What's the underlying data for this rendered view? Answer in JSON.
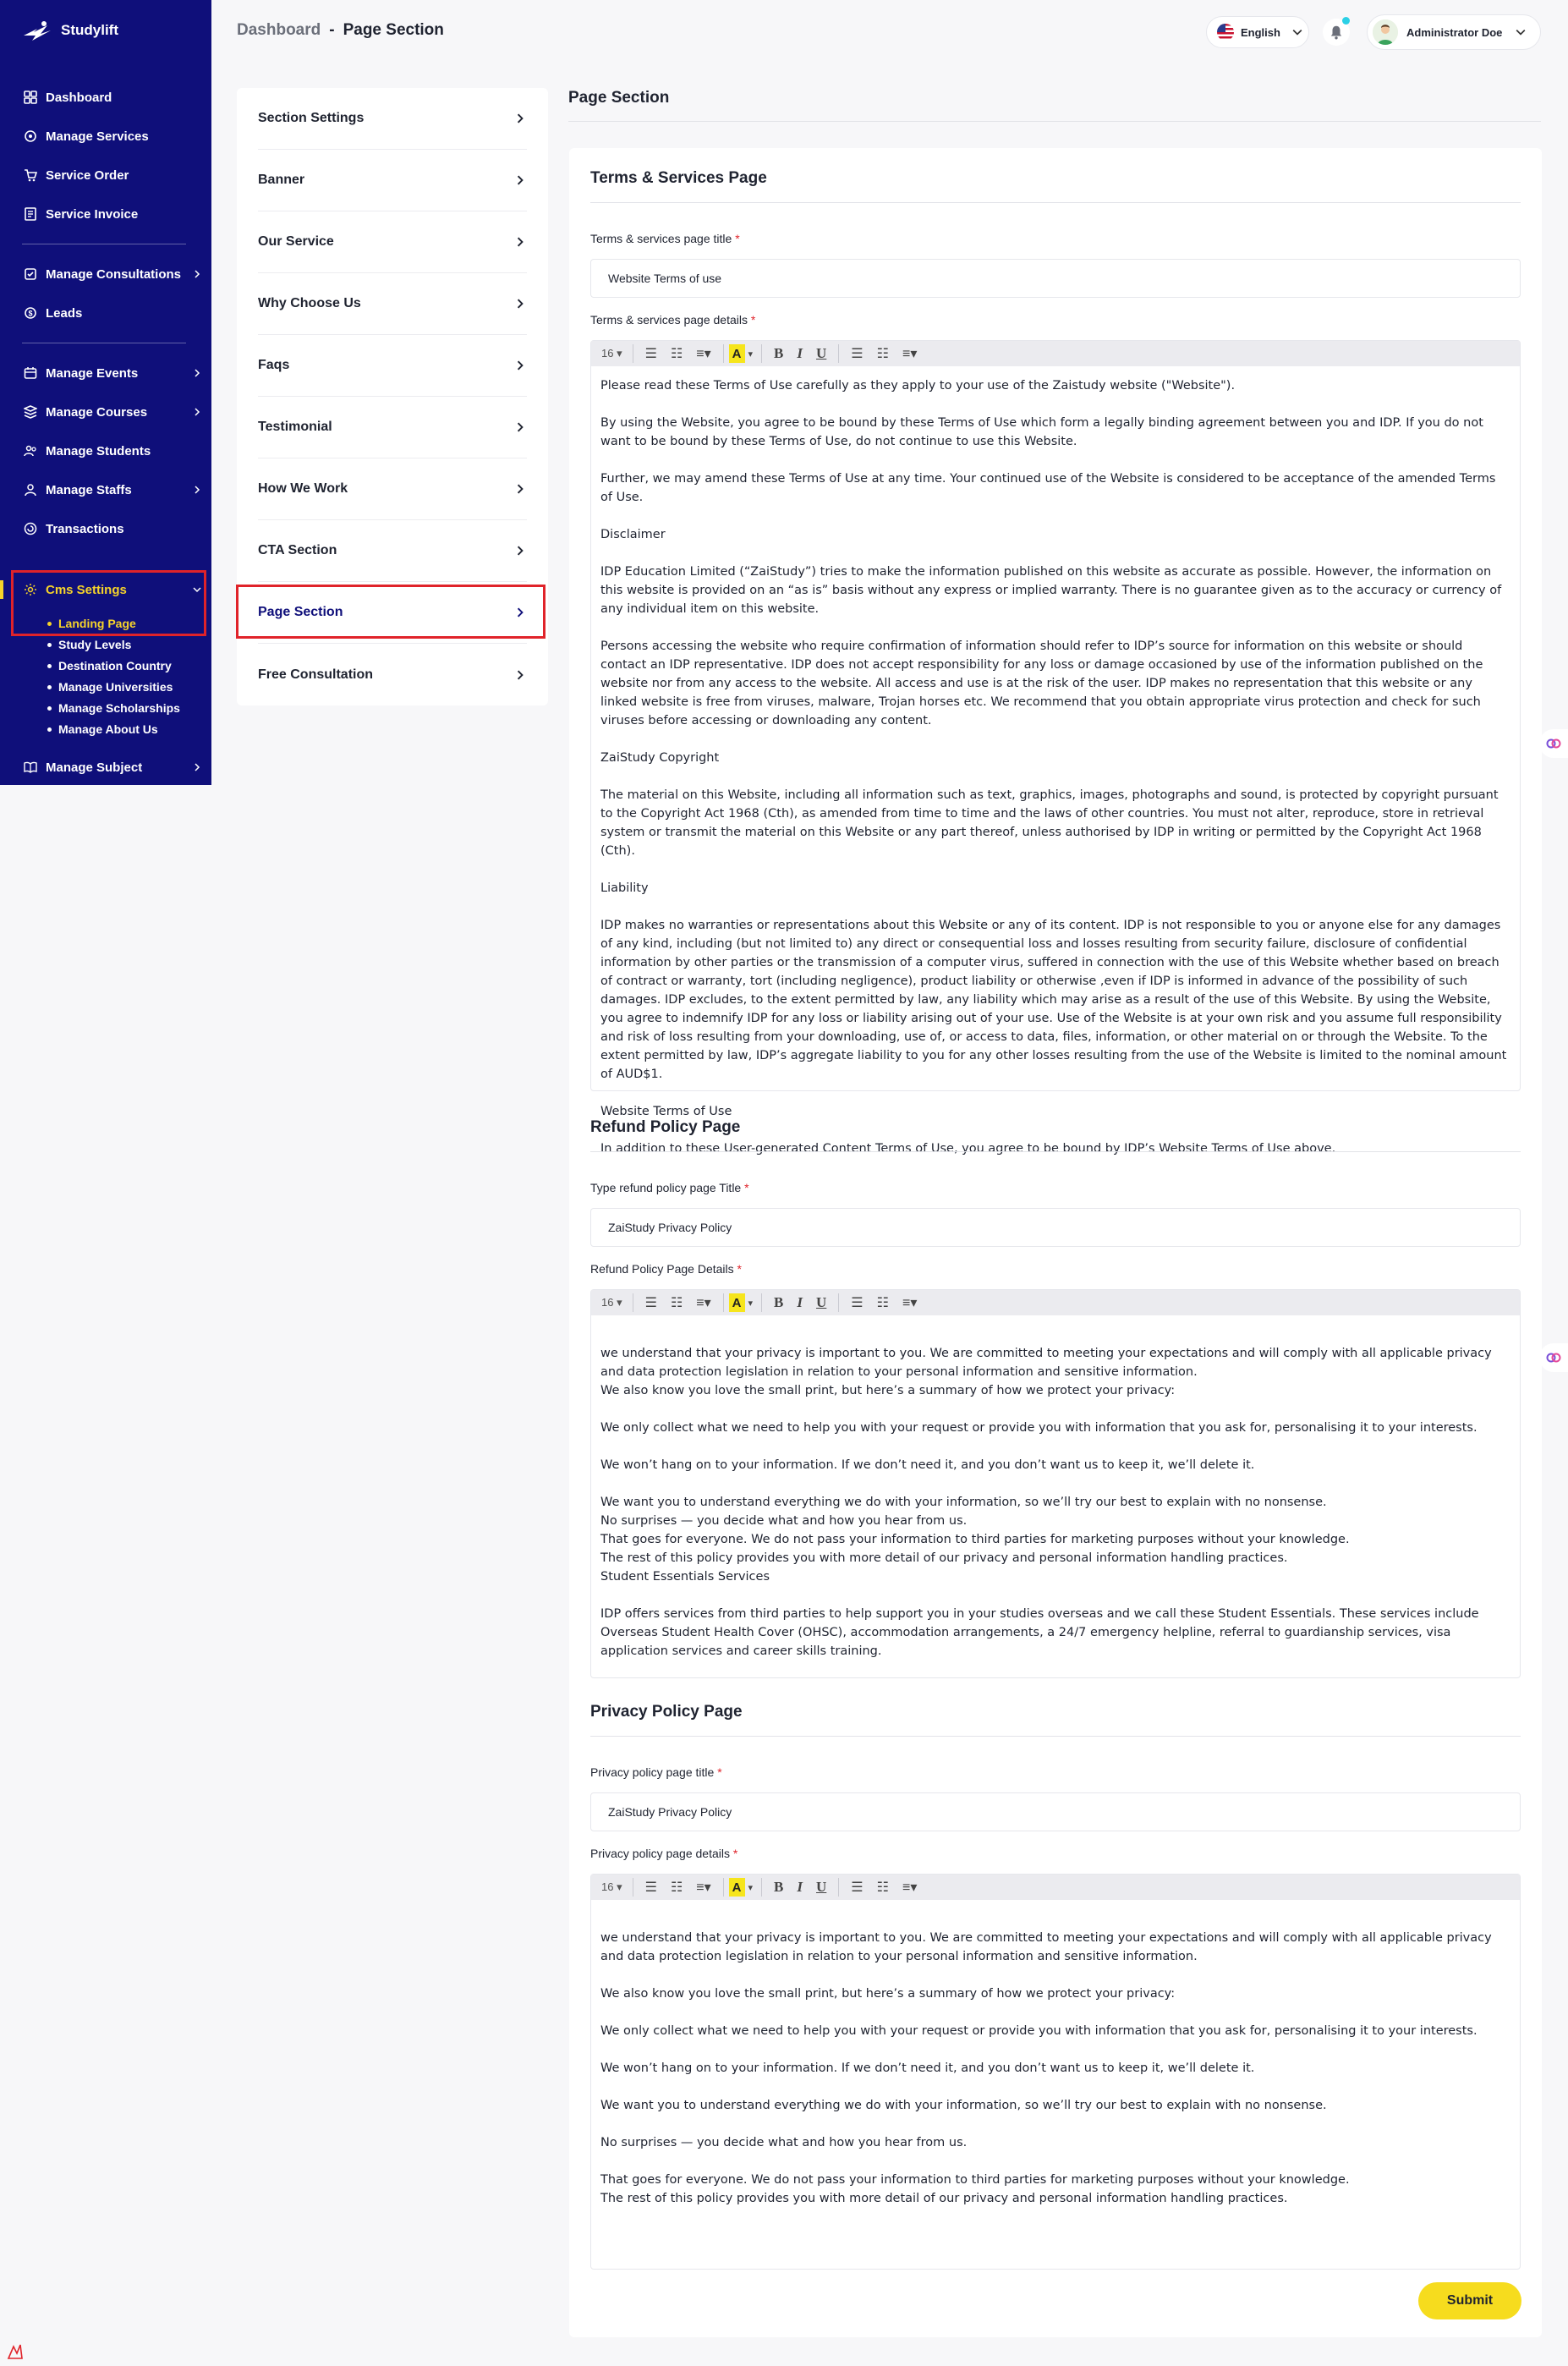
{
  "brand": {
    "name": "Studylift"
  },
  "sidebar": {
    "items": [
      {
        "label": "Dashboard",
        "icon": "dashboard-icon"
      },
      {
        "label": "Manage Services",
        "icon": "services-icon"
      },
      {
        "label": "Service Order",
        "icon": "order-icon"
      },
      {
        "label": "Service Invoice",
        "icon": "invoice-icon"
      },
      {
        "label": "Manage Consultations",
        "icon": "consultation-icon"
      },
      {
        "label": "Leads",
        "icon": "leads-icon"
      },
      {
        "label": "Manage Events",
        "icon": "events-icon"
      },
      {
        "label": "Manage Courses",
        "icon": "courses-icon"
      },
      {
        "label": "Manage Students",
        "icon": "students-icon"
      },
      {
        "label": "Manage Staffs",
        "icon": "staffs-icon"
      },
      {
        "label": "Transactions",
        "icon": "transactions-icon"
      },
      {
        "label": "Cms Settings",
        "icon": "cms-settings-icon"
      },
      {
        "label": "Manage Subject",
        "icon": "subject-icon"
      }
    ],
    "cms_sub_items": [
      "Landing Page",
      "Study Levels",
      "Destination Country",
      "Manage Universities",
      "Manage Scholarships",
      "Manage About Us"
    ]
  },
  "header": {
    "breadcrumb_root": "Dashboard",
    "breadcrumb_sep": "-",
    "breadcrumb_current": "Page Section",
    "language": "English",
    "user_name": "Administrator Doe"
  },
  "sections": [
    "Section Settings",
    "Banner",
    "Our Service",
    "Why Choose Us",
    "Faqs",
    "Testimonial",
    "How We Work",
    "CTA Section",
    "Page Section",
    "Free Consultation"
  ],
  "main": {
    "title": "Page Section",
    "toolbar": {
      "font_size": "16",
      "bold": "B",
      "italic": "I",
      "underline": "U",
      "color": "A"
    },
    "terms": {
      "heading": "Terms & Services Page",
      "title_label": "Terms & services page title",
      "title_value": "Website Terms of use",
      "details_label": "Terms & services page details",
      "paragraphs": [
        "Please read these Terms of Use carefully as they apply to your use of the Zaistudy website (\"Website\").",
        "By using the Website, you agree to be bound by these Terms of Use which form a legally binding agreement between you and IDP. If you do not want to be bound by these Terms of Use, do not continue to use this Website.",
        "Further, we may amend these Terms of Use at any time. Your continued use of the Website is considered to be acceptance of the amended Terms of Use.",
        "Disclaimer",
        "IDP Education Limited (“ZaiStudy”) tries to make the information published on this website as accurate as possible.  However, the information on this website is provided on an “as is” basis without any express or implied warranty. There is no guarantee given as to the accuracy or currency of any individual item on this website.",
        "Persons accessing the website who require confirmation of information should refer to IDP’s source for information on this website or should contact an IDP representative. IDP does not accept responsibility for any loss or damage occasioned by use of the information published on the website nor from any access to the website. All access and use is at the risk of the user. IDP makes no representation that this website or any linked website is free from viruses, malware, Trojan horses etc. We recommend that you obtain appropriate virus protection and check for such viruses before accessing or downloading any content.",
        "ZaiStudy Copyright",
        "The material on this Website, including all information such as text, graphics, images, photographs and sound, is protected by copyright pursuant to the Copyright Act 1968 (Cth), as amended from time to time and the laws of other countries. You must not alter, reproduce, store in retrieval system or transmit the material on this Website or any part thereof, unless authorised by IDP in writing or permitted by the Copyright Act 1968 (Cth).",
        "Liability",
        "IDP makes no warranties or representations about this Website or any of its content. IDP is not responsible to you or anyone else for any damages of any kind, including (but not limited to) any direct or consequential loss and losses resulting from security failure, disclosure of confidential information by other parties or the transmission of a computer virus, suffered in connection with the use of this Website whether based on breach of contract or warranty, tort (including negligence), product liability or otherwise ,even if IDP is informed in advance of the possibility of such damages. IDP excludes, to the extent permitted by law, any liability which may arise as a result of the use of this Website. By using the Website, you agree to indemnify IDP for any loss or liability arising out of your use. Use of the Website is at your own risk and you assume full responsibility and risk of loss resulting from your downloading, use of, or access to data, files, information, or other material on or through the Website. To the extent permitted by law, IDP’s aggregate liability to you for any other losses resulting from the use of the Website is limited to the nominal amount of AUD$1.",
        "Website Terms of Use",
        "In addition to these User-generated Content Terms of Use, you agree to be bound by IDP’s Website Terms of Use above."
      ]
    },
    "refund": {
      "heading": "Refund Policy Page",
      "title_label": "Type refund policy page Title",
      "title_value": "ZaiStudy Privacy Policy",
      "details_label": "Refund Policy Page Details",
      "p1": "we understand that your privacy is important to you. We are committed to meeting your expectations and will comply with all applicable privacy and data protection legislation in relation to your personal information and sensitive information.",
      "p2": "We also know you love the small print, but here’s a summary of how we protect your privacy:",
      "p3": "We only collect what we need to help you with your request or provide you with information that you ask for, personalising it to your interests.",
      "p4": "We won’t hang on to your information. If we don’t need it, and you don’t want us to keep it, we’ll delete it.",
      "p5": "We want you to understand everything we do with your information, so we’ll try our best to explain with no nonsense.",
      "p6": "No surprises — you decide what and how you hear from us.",
      "p7": "That goes for everyone. We do not pass your information to third parties for marketing purposes without your knowledge.",
      "p8": "The rest of this policy provides you with more detail of our privacy and personal information handling practices.",
      "p9": "Student Essentials Services",
      "p10": "IDP offers services from third parties to help support you in your studies overseas and we call these Student Essentials. These services include Overseas Student Health Cover (OHSC), accommodation arrangements, a 24/7 emergency helpline, referral to guardianship services, visa application services and career skills training."
    },
    "privacy": {
      "heading": "Privacy Policy Page",
      "title_label": "Privacy policy page title",
      "title_value": "ZaiStudy Privacy Policy",
      "details_label": "Privacy policy page details",
      "p1": "we understand that your privacy is important to you. We are committed to meeting your expectations and will comply with all applicable privacy and data protection legislation in relation to your personal information and sensitive information.",
      "p2": "We also know you love the small print, but here’s a summary of how we protect your privacy:",
      "p3": "We only collect what we need to help you with your request or provide you with information that you ask for, personalising it to your interests.",
      "p4": "We won’t hang on to your information. If we don’t need it, and you don’t want us to keep it, we’ll delete it.",
      "p5": "We want you to understand everything we do with your information, so we’ll try our best to explain with no nonsense.",
      "p6": "No surprises — you decide what and how you hear from us.",
      "p7": "That goes for everyone. We do not pass your information to third parties for marketing purposes without your knowledge.",
      "p8": "The rest of this policy provides you with more detail of our privacy and personal information handling practices."
    },
    "submit_label": "Submit"
  },
  "colors": {
    "sidebar_bg": "#0f0f7a",
    "accent_yellow": "#f6d32a",
    "highlight_red": "#e0232a"
  }
}
